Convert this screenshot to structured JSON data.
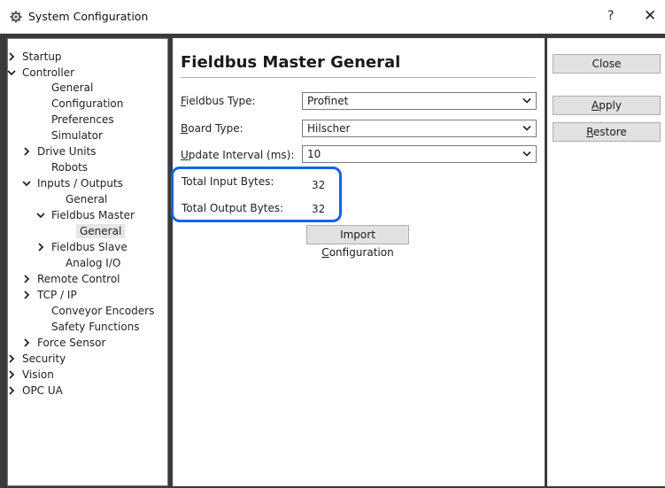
{
  "window": {
    "title": "System Configuration",
    "help": "?",
    "close": "✕"
  },
  "tree": {
    "items": [
      {
        "label": "Startup",
        "chevron": "right"
      },
      {
        "label": "Controller",
        "chevron": "down"
      },
      {
        "label": "General"
      },
      {
        "label": "Configuration"
      },
      {
        "label": "Preferences"
      },
      {
        "label": "Simulator"
      },
      {
        "label": "Drive Units",
        "chevron": "right"
      },
      {
        "label": "Robots"
      },
      {
        "label": "Inputs / Outputs",
        "chevron": "down"
      },
      {
        "label": "General"
      },
      {
        "label": "Fieldbus Master",
        "chevron": "down"
      },
      {
        "label": "General",
        "selected": true
      },
      {
        "label": "Fieldbus Slave",
        "chevron": "right"
      },
      {
        "label": "Analog I/O"
      },
      {
        "label": "Remote Control",
        "chevron": "right"
      },
      {
        "label": "TCP / IP",
        "chevron": "right"
      },
      {
        "label": "Conveyor Encoders"
      },
      {
        "label": "Safety Functions"
      },
      {
        "label": "Force Sensor",
        "chevron": "right"
      },
      {
        "label": "Security",
        "chevron": "right"
      },
      {
        "label": "Vision",
        "chevron": "right"
      },
      {
        "label": "OPC UA",
        "chevron": "right"
      }
    ]
  },
  "main": {
    "heading": "Fieldbus Master General",
    "fieldbus_type": {
      "label_mn": "F",
      "label_rest": "ieldbus Type:",
      "value": "Profinet"
    },
    "board_type": {
      "label_mn": "B",
      "label_rest": "oard Type:",
      "value": "Hilscher"
    },
    "update_interval": {
      "label_mn": "U",
      "label_rest": "pdate Interval (ms):",
      "value": "10"
    },
    "total_input": {
      "label": "Total Input Bytes:",
      "value": "32"
    },
    "total_output": {
      "label": "Total Output Bytes:",
      "value": "32"
    },
    "import_button": {
      "pre": "Import ",
      "mn": "C",
      "post": "onfiguration"
    }
  },
  "side": {
    "close": "Close",
    "apply": {
      "mn": "A",
      "rest": "pply"
    },
    "restore": {
      "mn": "R",
      "rest": "estore"
    }
  },
  "colors": {
    "highlight": "#1565e0",
    "frame": "#3a3a3a"
  }
}
